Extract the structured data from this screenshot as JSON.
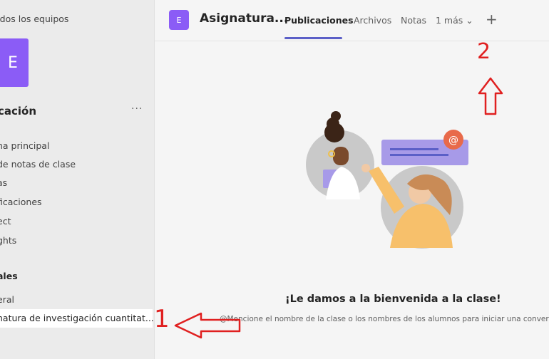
{
  "sidebar": {
    "back_label": "odos los equipos",
    "team_initial": "E",
    "team_name": "cación",
    "more": "···",
    "nav": [
      "na principal",
      "de notas de clase",
      "as",
      "ficaciones",
      "ect",
      "ghts"
    ],
    "channels_label": "ales",
    "channels": [
      "eral",
      "natura de investigación cuantitat..."
    ]
  },
  "header": {
    "avatar_initial": "E",
    "title": "Asignatura...",
    "tabs": [
      "Publicaciones",
      "Archivos",
      "Notas",
      "1 más ⌄"
    ],
    "plus": "+"
  },
  "main": {
    "welcome_title": "¡Le damos a la bienvenida a la clase!",
    "welcome_sub": "@Mencione el nombre de la clase o los nombres de los alumnos para iniciar una conversación"
  },
  "annotations": {
    "one": "1",
    "two": "2"
  },
  "colors": {
    "accent": "#5b5fc7",
    "team": "#8b5cf6",
    "annotation": "#e02020"
  }
}
